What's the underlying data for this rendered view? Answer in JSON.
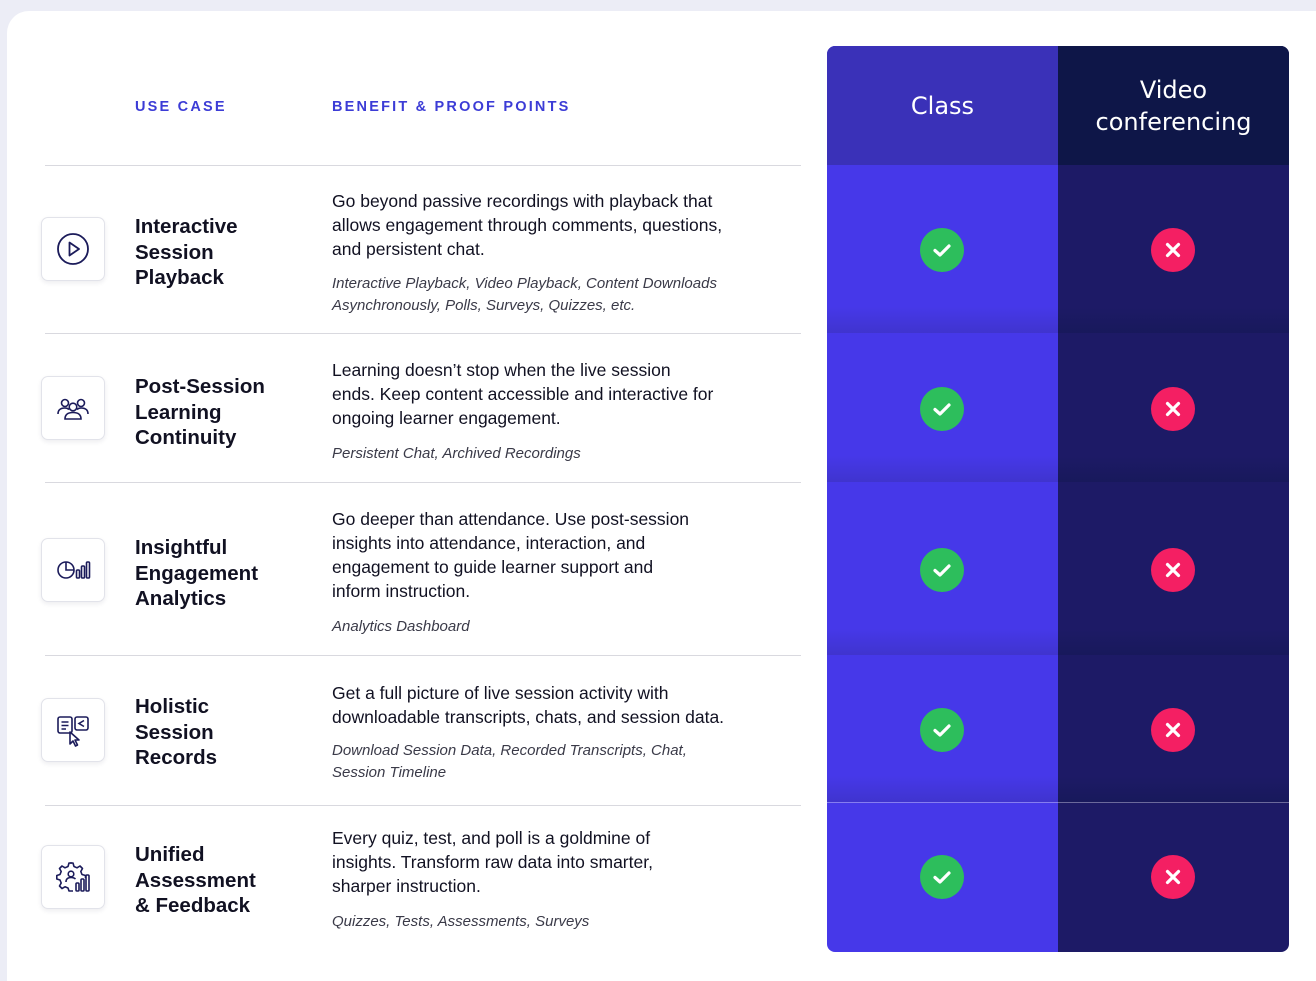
{
  "header": {
    "use_case_label": "USE CASE",
    "benefit_label": "BENEFIT & PROOF POINTS",
    "col_class": "Class",
    "col_video_line1": "Video",
    "col_video_line2": "conferencing"
  },
  "colors": {
    "accent": "#3C3CD6",
    "class_column": "#4638E9",
    "video_column": "#1D1A66",
    "check": "#2DBE5C",
    "cross": "#F41F63"
  },
  "rows": [
    {
      "icon": "play-circle-icon",
      "title_lines": [
        "Interactive",
        "Session",
        "Playback"
      ],
      "benefit_lines": [
        "Go beyond passive recordings with playback that",
        "allows engagement through comments, questions,",
        "and persistent chat."
      ],
      "proof_lines": [
        "Interactive Playback, Video Playback, Content Downloads",
        "Asynchronously, Polls, Surveys, Quizzes, etc."
      ],
      "class_supported": true,
      "video_supported": false
    },
    {
      "icon": "users-group-icon",
      "title_lines": [
        "Post-Session",
        "Learning",
        "Continuity"
      ],
      "benefit_lines": [
        "Learning doesn’t stop when the live session",
        "ends. Keep content accessible and interactive for",
        "ongoing learner engagement."
      ],
      "proof_lines": [
        "Persistent Chat, Archived Recordings"
      ],
      "class_supported": true,
      "video_supported": false
    },
    {
      "icon": "analytics-chart-icon",
      "title_lines": [
        "Insightful",
        "Engagement",
        "Analytics"
      ],
      "benefit_lines": [
        "Go deeper than attendance. Use post-session",
        "insights into attendance, interaction, and",
        "engagement to guide learner support and",
        "inform instruction."
      ],
      "proof_lines": [
        "Analytics Dashboard"
      ],
      "class_supported": true,
      "video_supported": false
    },
    {
      "icon": "transcript-cursor-icon",
      "title_lines": [
        "Holistic",
        "Session",
        "Records"
      ],
      "benefit_lines": [
        "Get a full picture of live session activity with",
        "downloadable transcripts, chats, and session data."
      ],
      "proof_lines": [
        "Download Session Data, Recorded Transcripts, Chat,",
        "Session Timeline"
      ],
      "class_supported": true,
      "video_supported": false
    },
    {
      "icon": "assessment-gear-icon",
      "title_lines": [
        "Unified",
        "Assessment",
        "& Feedback"
      ],
      "benefit_lines": [
        "Every quiz, test, and poll is a goldmine of",
        "insights. Transform raw data into smarter,",
        "sharper instruction."
      ],
      "proof_lines": [
        "Quizzes, Tests, Assessments, Surveys"
      ],
      "class_supported": true,
      "video_supported": false
    }
  ]
}
